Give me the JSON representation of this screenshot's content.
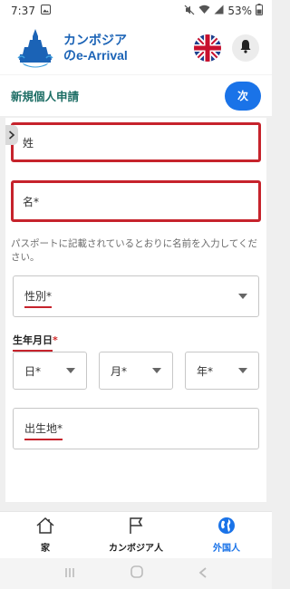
{
  "status_bar": {
    "time": "7:37",
    "battery": "53%"
  },
  "header": {
    "title_line1": "カンボジア",
    "title_line2": "のe-Arrival"
  },
  "title_row": {
    "title": "新規個人申請",
    "next_label": "次"
  },
  "form": {
    "surname_placeholder": "姓",
    "given_name_placeholder": "名*",
    "help_text": "パスポートに記載されているとおりに名前を入力してください。",
    "gender_label": "性別",
    "gender_required": "*",
    "dob_label": "生年月日",
    "dob_required": "*",
    "day_label": "日*",
    "month_label": "月*",
    "year_label": "年*",
    "birthplace_label": "出生地",
    "birthplace_required": "*"
  },
  "bottom_nav": {
    "items": [
      {
        "label": "家",
        "icon": "home-icon",
        "active": false
      },
      {
        "label": "カンボジア人",
        "icon": "flag-icon",
        "active": false
      },
      {
        "label": "外国人",
        "icon": "globe-icon",
        "active": true
      }
    ]
  },
  "colors": {
    "accent": "#1a73e8",
    "highlight": "#c6232c",
    "brand": "#1b63b6",
    "title": "#1c6d64"
  }
}
